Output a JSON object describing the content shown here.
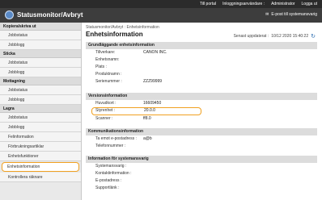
{
  "topbar": {
    "links": [
      "Till portal",
      "Inloggningsanvändare :",
      "Administrator",
      "Logga ut"
    ]
  },
  "header": {
    "app_title": "Statusmonitor/Avbryt",
    "mail_link": "E-post till systemansvarig"
  },
  "sidebar": {
    "groups": [
      {
        "label": "Kopiera/skriva ut",
        "items": [
          "Jobbstatus",
          "Jobblogg"
        ]
      },
      {
        "label": "Sticka",
        "items": [
          "Jobbstatus",
          "Jobblogg"
        ]
      },
      {
        "label": "Mottagning",
        "items": [
          "Jobbstatus",
          "Jobblogg"
        ]
      },
      {
        "label": "Lagra",
        "items": [
          "Jobbstatus",
          "Jobblogg"
        ]
      }
    ],
    "extra_items": [
      "Felinformation",
      "Förbrukningsartiklar",
      "Enhetsfunktioner",
      "Enhetsinformation",
      "Kontrollera räknare"
    ],
    "active_item": "Enhetsinformation"
  },
  "main": {
    "breadcrumb": "Statusmonitor/Avbryt : Enhetsinformation",
    "title": "Enhetsinformation",
    "updated_label": "Senast uppdaterat :",
    "updated_value": "10/12 2020 15:40:22",
    "sections": [
      {
        "heading": "Grundläggande enhetsinformation",
        "rows": [
          {
            "label": "Tillverkare:",
            "value": "CANON INC."
          },
          {
            "label": "Enhetsnamn:",
            "value": ""
          },
          {
            "label": "Plats :",
            "value": ""
          },
          {
            "label": "Produktnamn :",
            "value": ""
          },
          {
            "label": "Serienummer :",
            "value": "ZZZ99999"
          }
        ]
      },
      {
        "heading": "Versionsinformation",
        "rows": [
          {
            "label": "Huvudkort :",
            "value": "16609450"
          },
          {
            "label": "Styrenhet :",
            "value": "20.0.0"
          },
          {
            "label": "Scanner :",
            "value": "ff8.0"
          }
        ]
      },
      {
        "heading": "Kommunikationsinformation",
        "rows": [
          {
            "label": "Ta emot e-postadress :",
            "value": "a@b"
          },
          {
            "label": "Telefonnummer :",
            "value": ""
          }
        ]
      },
      {
        "heading": "Information för systemansvarig",
        "rows": [
          {
            "label": "Systemansvarig :",
            "value": ""
          },
          {
            "label": "Kontaktinformation :",
            "value": ""
          },
          {
            "label": "E-postadress :",
            "value": ""
          },
          {
            "label": "Supportlänk :",
            "value": ""
          }
        ]
      }
    ]
  }
}
